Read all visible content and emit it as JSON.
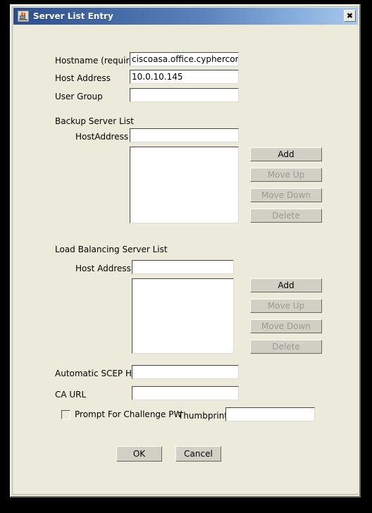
{
  "window": {
    "title": "Server List Entry",
    "icon": "java-coffee-cup-icon",
    "close_label": "✖",
    "colors": {
      "titlebar_left": "#2B4E8F",
      "titlebar_right": "#A8C8EC",
      "dialog_background": "#ECEADA",
      "field_background": "#FFFFFF",
      "button_face": "#D2D0C4",
      "disabled_text": "#9A9A92"
    }
  },
  "form": {
    "hostname": {
      "label": "Hostname (required)",
      "value": "ciscoasa.office.cyphercor.com",
      "placeholder": ""
    },
    "host_address": {
      "label": "Host Address",
      "value": "10.0.10.145",
      "placeholder": ""
    },
    "user_group": {
      "label": "User Group",
      "value": "",
      "placeholder": ""
    }
  },
  "backup_server_list": {
    "section_label": "Backup Server List",
    "host_address": {
      "label": "HostAddress",
      "value": "",
      "placeholder": ""
    },
    "list_items": [],
    "buttons": [
      {
        "label": "Add",
        "enabled": true
      },
      {
        "label": "Move Up",
        "enabled": false
      },
      {
        "label": "Move Down",
        "enabled": false
      },
      {
        "label": "Delete",
        "enabled": false
      }
    ]
  },
  "load_balancing_server_list": {
    "section_label": "Load Balancing Server List",
    "host_address": {
      "label": "Host Address",
      "value": "",
      "placeholder": ""
    },
    "list_items": [],
    "buttons": [
      {
        "label": "Add",
        "enabled": true
      },
      {
        "label": "Move Up",
        "enabled": false
      },
      {
        "label": "Move Down",
        "enabled": false
      },
      {
        "label": "Delete",
        "enabled": false
      }
    ]
  },
  "scep": {
    "automatic_scep_host": {
      "label": "Automatic SCEP Host",
      "value": "",
      "placeholder": ""
    },
    "ca_url": {
      "label": "CA URL",
      "value": "",
      "placeholder": ""
    },
    "prompt_for_challenge_pw": {
      "label": "Prompt For Challenge PW",
      "checked": false
    },
    "thumbprint": {
      "label": "Thumbprint",
      "value": "",
      "placeholder": ""
    }
  },
  "actions": {
    "ok_label": "OK",
    "cancel_label": "Cancel"
  }
}
